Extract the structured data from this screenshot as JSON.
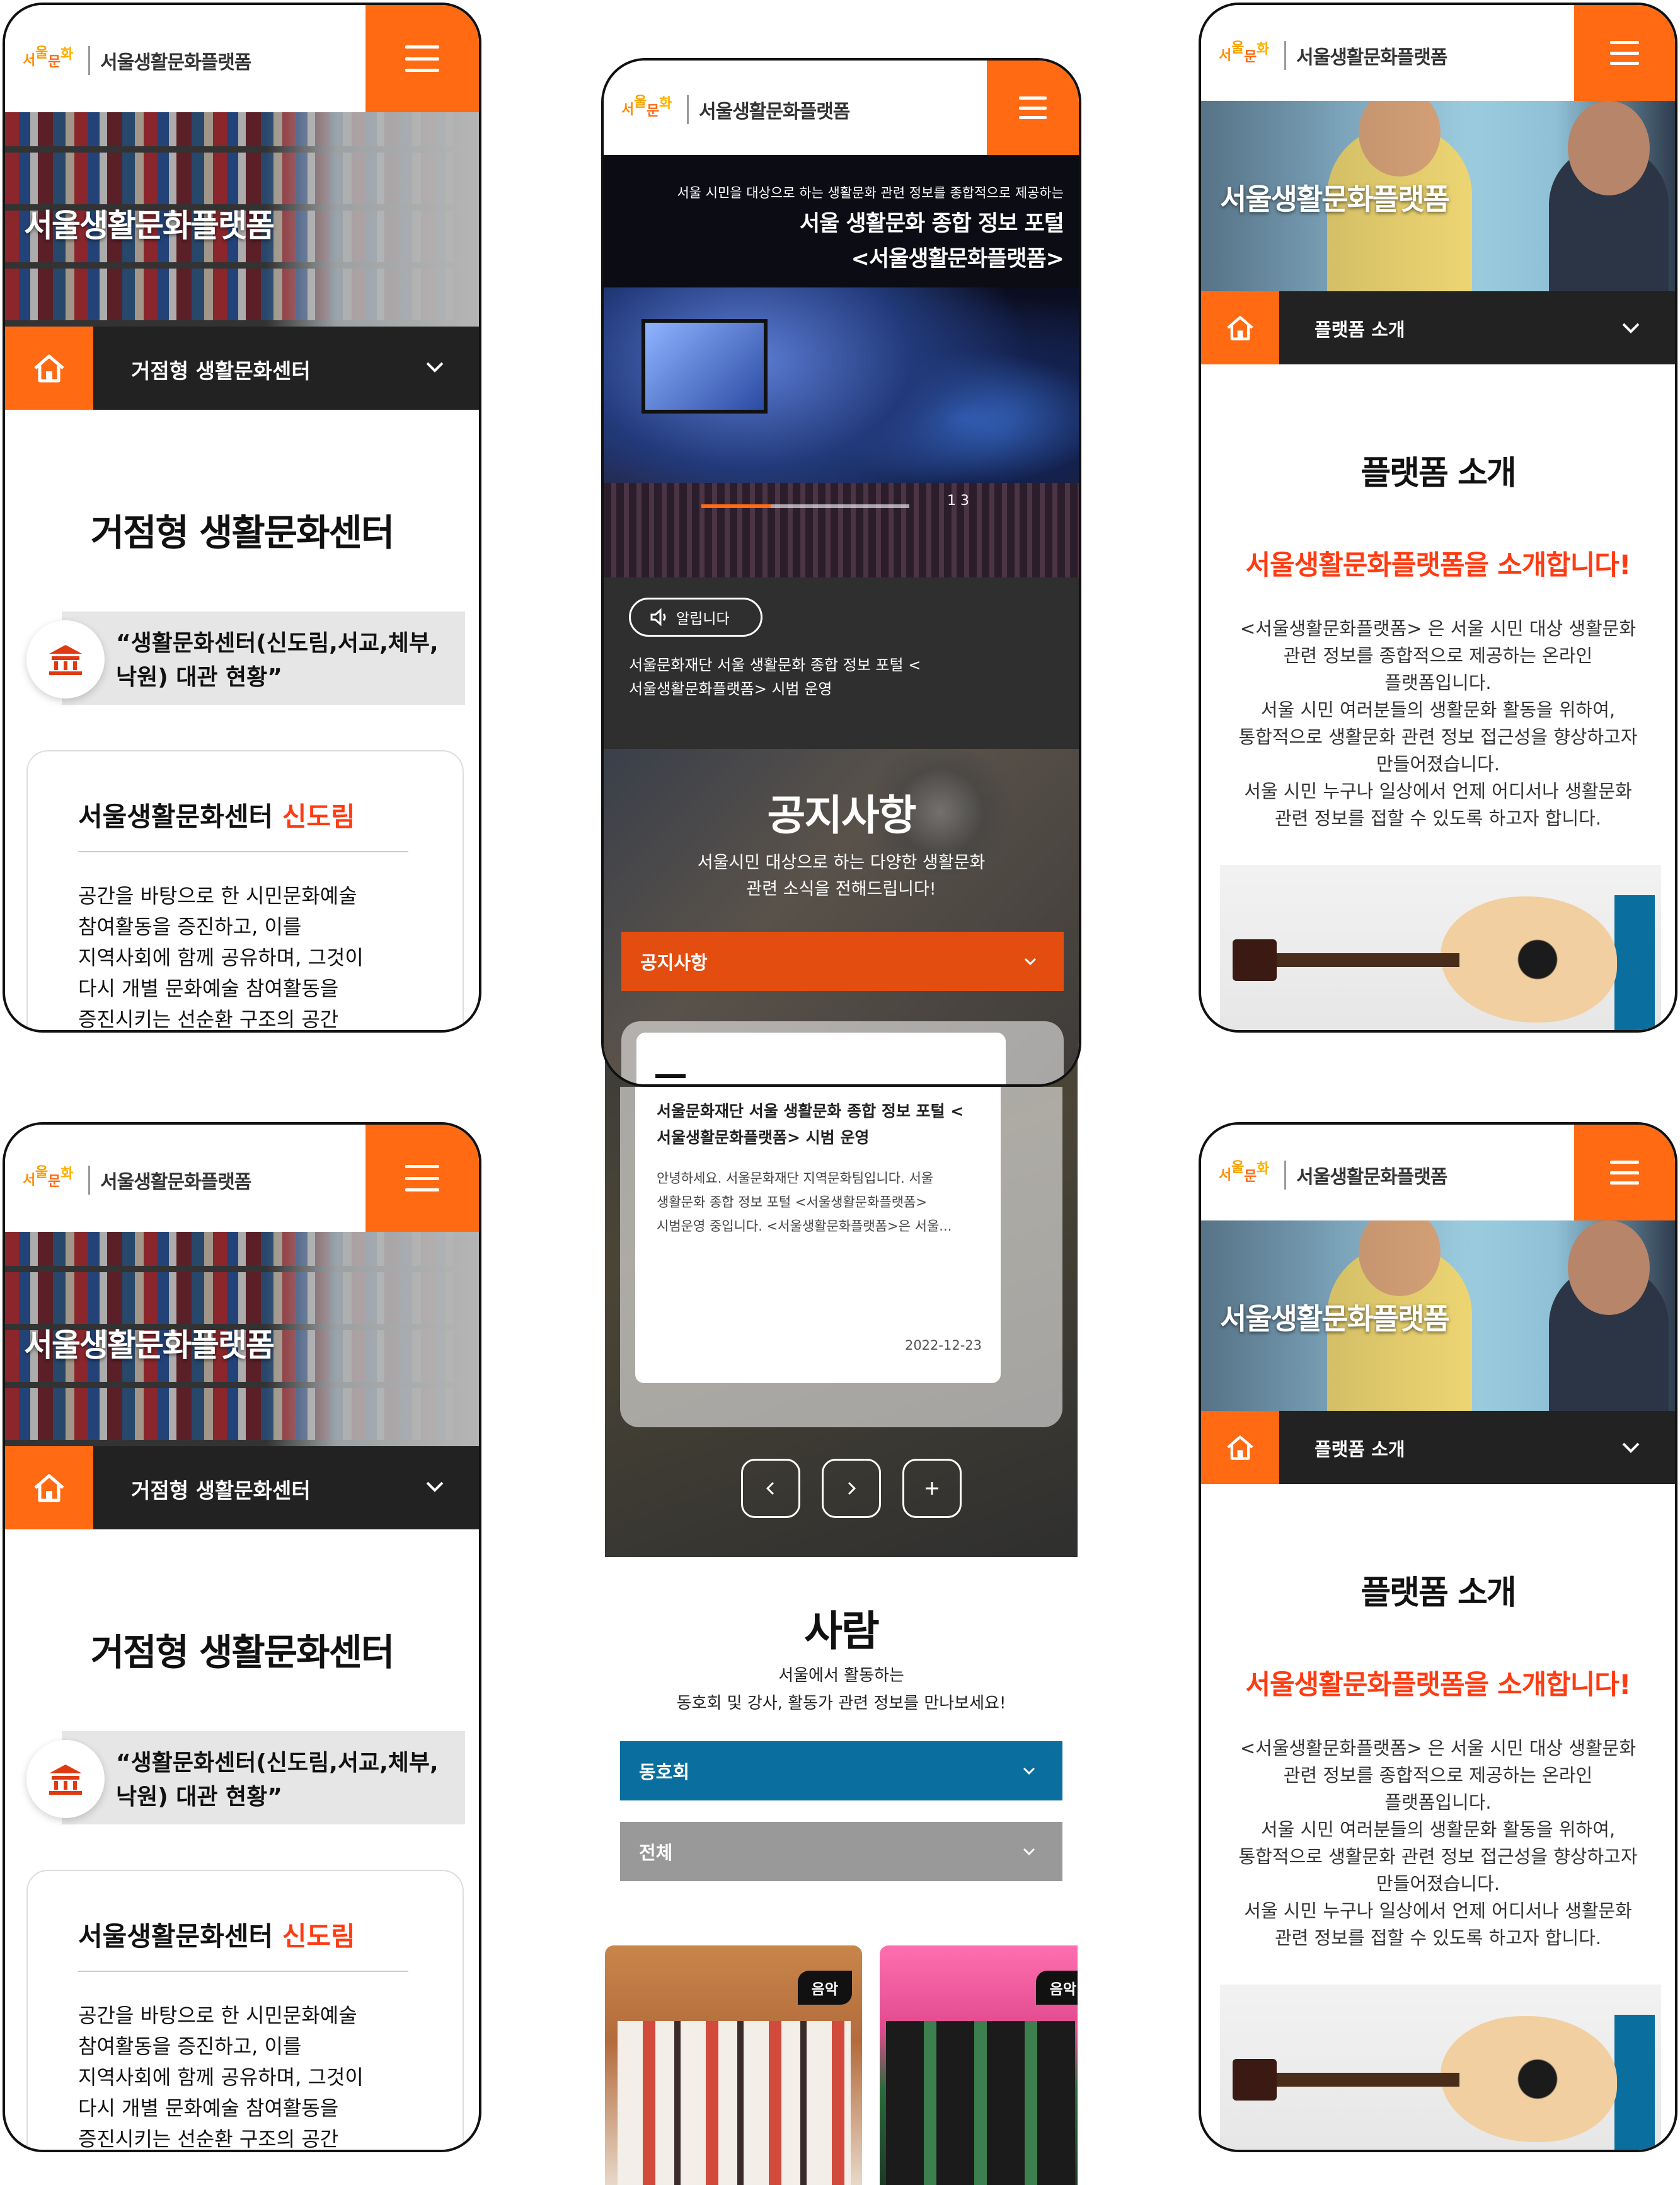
{
  "brand": {
    "name": "서울생활문화플랫폼",
    "logo_text": "서울문화생활",
    "accent": "#ff6a13",
    "dark": "#222222",
    "blue": "#0a6e9e"
  },
  "center_screen": {
    "hero": {
      "subtitle": "서울 시민을 대상으로 하는 생활문화 관련 정보를 종합적으로 제공하는",
      "title_line1": "서울 생활문화 종합 정보 포털",
      "title_line2": "<서울생활문화플랫폼>"
    },
    "slider": {
      "current": "1",
      "total": "3"
    },
    "announce": {
      "badge": "알립니다",
      "text_line1": "서울문화재단 서울 생활문화 종합 정보 포털 <",
      "text_line2": "서울생활문화플랫폼> 시범 운영"
    },
    "notice": {
      "title": "공지사항",
      "desc_line1": "서울시민 대상으로 하는 다양한 생활문화",
      "desc_line2": "관련 소식을 전해드립니다!",
      "dropdown": "공지사항",
      "card": {
        "title_line1": "서울문화재단 서울 생활문화 종합 정보 포털 <",
        "title_line2": "서울생활문화플랫폼> 시범 운영",
        "body_line1": "안녕하세요. 서울문화재단 지역문화팀입니다. 서울",
        "body_line2": "생활문화 종합 정보 포털 <서울생활문화플랫폼>",
        "body_line3": "시범운영 중입니다. <서울생활문화플랫폼>은 서울...",
        "date": "2022-12-23"
      }
    },
    "people": {
      "title": "사람",
      "desc_line1": "서울에서 활동하는",
      "desc_line2": "동호회 및 강사, 활동가 관련 정보를 만나보세요!",
      "dropdown1": "동호회",
      "dropdown2": "전체",
      "tag1": "음악",
      "tag2": "음악"
    }
  },
  "left_screen": {
    "hero_title": "서울생활문화플랫폼",
    "nav_label": "거점형 생활문화센터",
    "section_title": "거점형 생활문화센터",
    "quote_line1": "“생활문화센터(신도림,서교,체부,",
    "quote_line2": "낙원) 대관 현황”",
    "card_title": "서울생활문화센터",
    "card_highlight": "신도림",
    "card_body": [
      "공간을 바탕으로 한 시민문화예술",
      "참여활동을 증진하고, 이를",
      "지역사회에 함께 공유하며, 그것이",
      "다시 개별 문화예술 참여활동을",
      "증진시키는 선순환 구조의 공간"
    ]
  },
  "right_screen": {
    "hero_title": "서울생활문화플랫폼",
    "nav_label": "플랫폼 소개",
    "section_title": "플랫폼 소개",
    "headline": "서울생활문화플랫폼을 소개합니다!",
    "body": [
      "<서울생활문화플랫폼> 은 서울 시민 대상 생활문화",
      "관련 정보를 종합적으로 제공하는 온라인",
      "플랫폼입니다.",
      "서울 시민 여러분들의 생활문화 활동을 위하여,",
      "통합적으로 생활문화 관련 정보 접근성을 향상하고자",
      "만들어졌습니다.",
      "서울 시민 누구나 일상에서 언제 어디서나 생활문화",
      "관련 정보를 접할 수 있도록 하고자 합니다."
    ]
  }
}
